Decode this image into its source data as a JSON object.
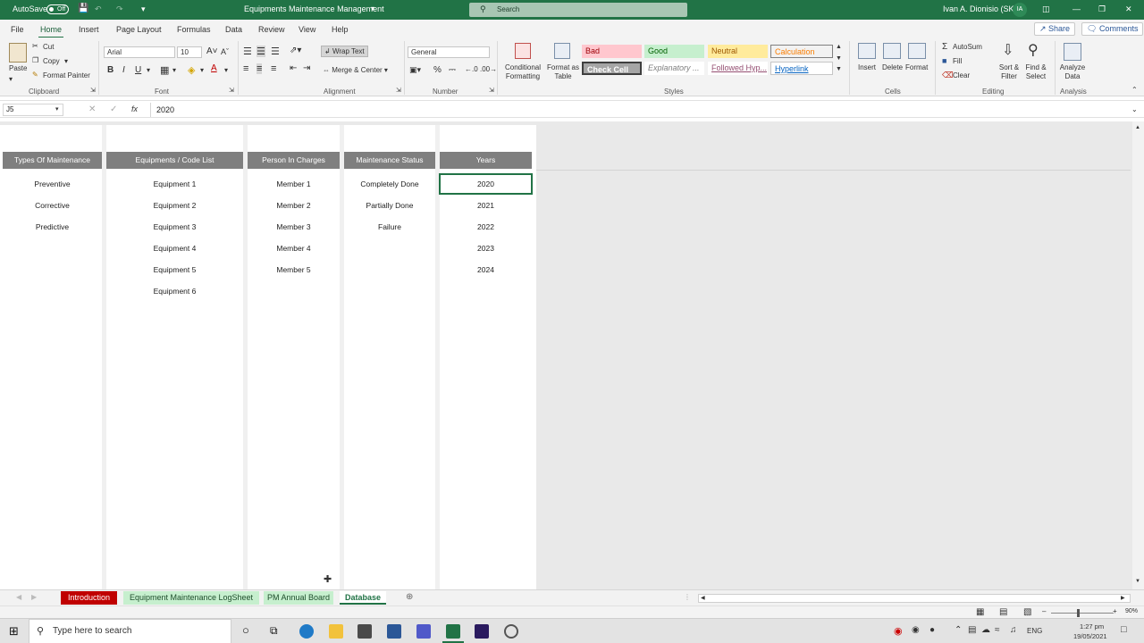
{
  "titlebar": {
    "autosave_label": "AutoSave",
    "autosave_state": "Off",
    "doc_title": "Equipments Maintenance Management",
    "search_placeholder": "Search",
    "user_name": "Ivan A. Dionisio (SK)",
    "user_initials": "IA"
  },
  "menu": {
    "items": [
      "File",
      "Home",
      "Insert",
      "Page Layout",
      "Formulas",
      "Data",
      "Review",
      "View",
      "Help"
    ],
    "active": "Home",
    "share_label": "Share",
    "comments_label": "Comments"
  },
  "ribbon": {
    "clipboard": {
      "paste": "Paste",
      "cut": "Cut",
      "copy": "Copy",
      "format_painter": "Format Painter",
      "group": "Clipboard"
    },
    "font": {
      "family": "Arial",
      "size": "10",
      "group": "Font",
      "bold": "B",
      "italic": "I",
      "underline": "U"
    },
    "alignment": {
      "wrap_text": "Wrap Text",
      "merge_center": "Merge & Center",
      "group": "Alignment"
    },
    "number": {
      "format": "General",
      "group": "Number"
    },
    "styles": {
      "conditional": "Conditional Formatting",
      "format_table": "Format as Table",
      "cells": [
        {
          "label": "Bad",
          "bg": "#ffc7ce",
          "fg": "#9c0006"
        },
        {
          "label": "Good",
          "bg": "#c6efce",
          "fg": "#006100"
        },
        {
          "label": "Neutral",
          "bg": "#ffeb9c",
          "fg": "#9c5700"
        },
        {
          "label": "Calculation",
          "bg": "#f2f2f2",
          "fg": "#fa7d00"
        },
        {
          "label": "Check Cell",
          "bg": "#a5a5a5",
          "fg": "#ffffff"
        },
        {
          "label": "Explanatory ...",
          "bg": "#ffffff",
          "fg": "#7f7f7f"
        },
        {
          "label": "Followed Hyp...",
          "bg": "#ffffff",
          "fg": "#954f72"
        },
        {
          "label": "Hyperlink",
          "bg": "#ffffff",
          "fg": "#0563c1"
        }
      ],
      "group": "Styles"
    },
    "cells_group": {
      "insert": "Insert",
      "delete": "Delete",
      "format": "Format",
      "group": "Cells"
    },
    "editing": {
      "autosum": "AutoSum",
      "fill": "Fill",
      "clear": "Clear",
      "sort_filter": "Sort & Filter",
      "find_select": "Find & Select",
      "group": "Editing"
    },
    "analysis": {
      "analyze": "Analyze Data",
      "group": "Analysis"
    }
  },
  "formula_bar": {
    "name_box": "J5",
    "value": "2020"
  },
  "sheet": {
    "headers": [
      "Types Of Maintenance",
      "Equipments / Code List",
      "Person In Charges",
      "Maintenance Status",
      "Years"
    ],
    "types": [
      "Preventive",
      "Corrective",
      "Predictive"
    ],
    "equipments": [
      "Equipment 1",
      "Equipment 2",
      "Equipment 3",
      "Equipment 4",
      "Equipment 5",
      "Equipment 6"
    ],
    "persons": [
      "Member 1",
      "Member 2",
      "Member 3",
      "Member 4",
      "Member 5"
    ],
    "statuses": [
      "Completely Done",
      "Partially Done",
      "Failure"
    ],
    "years": [
      "2020",
      "2021",
      "2022",
      "2023",
      "2024"
    ]
  },
  "tabs": [
    {
      "label": "Introduction",
      "bg": "#c00000",
      "fg": "#ffffff"
    },
    {
      "label": "Equipment Maintenance LogSheet",
      "bg": "#c6efce",
      "fg": "#1e4d2b"
    },
    {
      "label": "PM Annual Board",
      "bg": "#c6efce",
      "fg": "#1e4d2b"
    },
    {
      "label": "Database",
      "bg": "#ffffff",
      "fg": "#217346",
      "active": true
    }
  ],
  "statusbar": {
    "zoom": "90%"
  },
  "taskbar": {
    "search_placeholder": "Type here to search",
    "lang": "ENG",
    "time": "1:27 pm",
    "date": "19/05/2021"
  }
}
